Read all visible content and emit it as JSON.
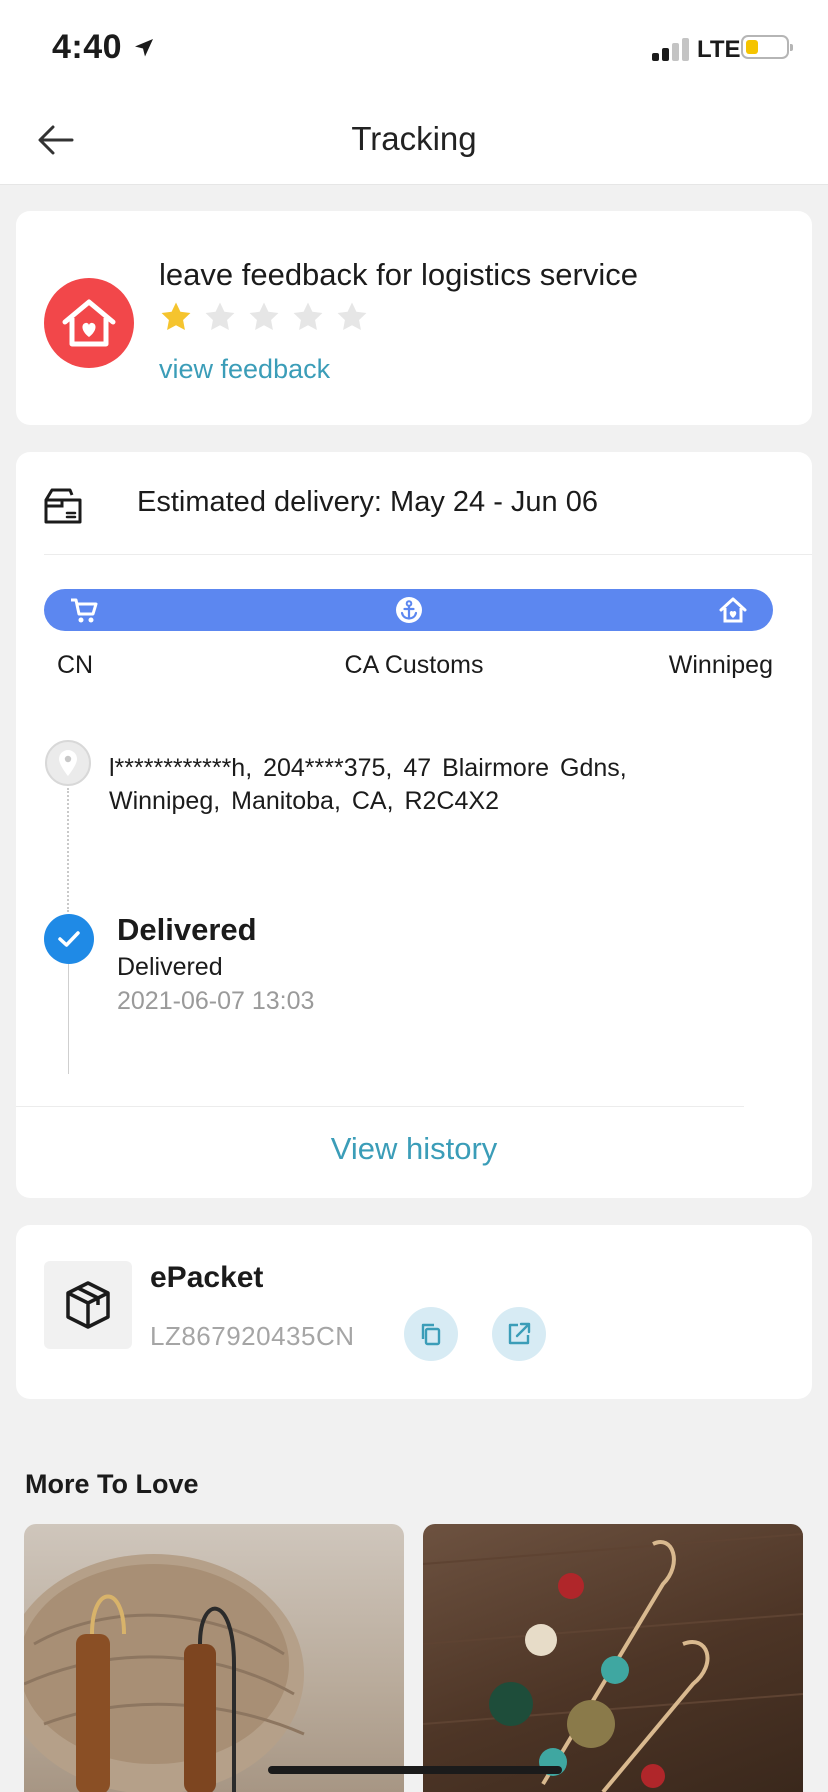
{
  "status_bar": {
    "time": "4:40",
    "network": "LTE",
    "battery_level": 0.2,
    "signal_bars": 2
  },
  "nav": {
    "title": "Tracking",
    "back_icon": "arrow-left-icon"
  },
  "feedback": {
    "title": "leave feedback for logistics service",
    "rating": 1,
    "max_rating": 5,
    "link": "view feedback",
    "icon": "house-heart-icon",
    "star_color": "#f5c42e",
    "star_empty_color": "#e6e6e6"
  },
  "tracking": {
    "estimated_delivery": "Estimated delivery: May 24 - Jun 06",
    "stops": [
      "CN",
      "CA Customs",
      "Winnipeg"
    ],
    "progress_color": "#5c87f0",
    "address": "l************h,  204****375,  47 Blairmore Gdns,  Winnipeg,  Manitoba,  CA,  R2C4X2",
    "events": [
      {
        "title": "Delivered",
        "subtitle": "Delivered",
        "time": "2021-06-07 13:03"
      }
    ],
    "view_history": "View history"
  },
  "package": {
    "carrier": "ePacket",
    "tracking_number": "LZ867920435CN",
    "copy_icon": "copy-icon",
    "open_icon": "external-link-icon"
  },
  "recommendations": {
    "title": "More To Love"
  },
  "colors": {
    "accent_link": "#3b9db8",
    "badge_red": "#f2474a",
    "check_blue": "#1f8ae6"
  }
}
